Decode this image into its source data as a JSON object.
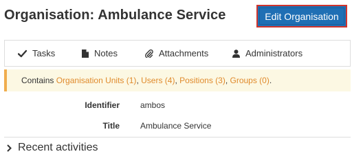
{
  "header": {
    "title": "Organisation: Ambulance Service",
    "edit_button": "Edit Organisation"
  },
  "tabs": [
    {
      "label": "Tasks",
      "icon": "check-icon"
    },
    {
      "label": "Notes",
      "icon": "file-icon"
    },
    {
      "label": "Attachments",
      "icon": "paperclip-icon"
    },
    {
      "label": "Administrators",
      "icon": "user-icon"
    }
  ],
  "contains": {
    "prefix": "Contains",
    "links": [
      {
        "text": "Organisation Units (1)"
      },
      {
        "text": "Users (4)"
      },
      {
        "text": "Positions (3)"
      },
      {
        "text": "Groups (0)"
      }
    ],
    "separator": ", ",
    "suffix": "."
  },
  "details": [
    {
      "key": "Identifier",
      "value": "ambos"
    },
    {
      "key": "Title",
      "value": "Ambulance Service"
    }
  ],
  "recent": {
    "label": "Recent activities",
    "icon": "chevron-right-icon"
  },
  "colors": {
    "accent_blue": "#1f6fb4",
    "highlight_red": "#d0342c",
    "link_orange": "#e08a2c",
    "alert_bg": "#fcf8e3",
    "alert_border": "#f0ad4e"
  }
}
